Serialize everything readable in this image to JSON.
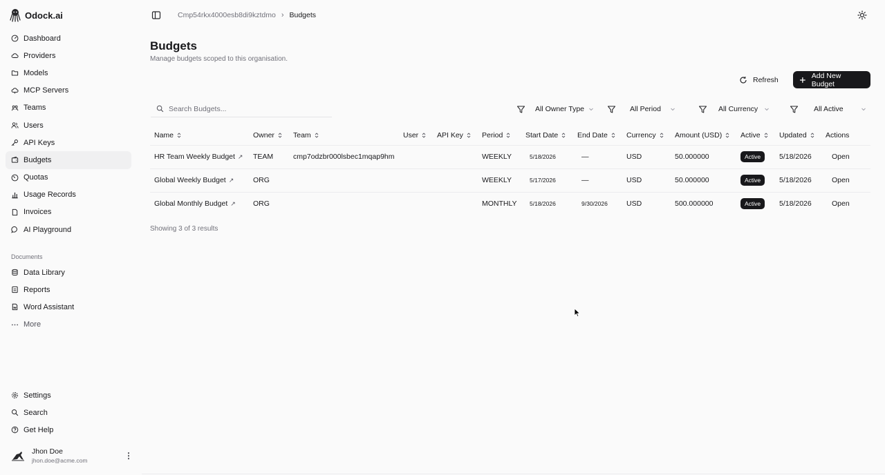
{
  "app": {
    "name": "Odock.ai"
  },
  "sidebar": {
    "items": [
      {
        "label": "Dashboard",
        "icon": "gauge-icon"
      },
      {
        "label": "Providers",
        "icon": "cloud-icon"
      },
      {
        "label": "Models",
        "icon": "folder-icon"
      },
      {
        "label": "MCP Servers",
        "icon": "cloud-server-icon"
      },
      {
        "label": "Teams",
        "icon": "team-icon"
      },
      {
        "label": "Users",
        "icon": "users-icon"
      },
      {
        "label": "API Keys",
        "icon": "key-icon"
      },
      {
        "label": "Budgets",
        "icon": "wallet-icon",
        "active": true
      },
      {
        "label": "Quotas",
        "icon": "gauge-alt-icon"
      },
      {
        "label": "Usage Records",
        "icon": "bar-chart-icon"
      },
      {
        "label": "Invoices",
        "icon": "file-icon"
      },
      {
        "label": "AI Playground",
        "icon": "chat-icon"
      }
    ],
    "documents_label": "Documents",
    "documents": [
      {
        "label": "Data Library",
        "icon": "database-icon"
      },
      {
        "label": "Reports",
        "icon": "report-icon"
      },
      {
        "label": "Word Assistant",
        "icon": "word-icon"
      },
      {
        "label": "More",
        "icon": "dots-icon"
      }
    ],
    "footer": [
      {
        "label": "Settings",
        "icon": "gear-icon"
      },
      {
        "label": "Search",
        "icon": "search-icon"
      },
      {
        "label": "Get Help",
        "icon": "help-icon"
      }
    ],
    "user": {
      "name": "Jhon Doe",
      "email": "jhon.doe@acme.com"
    }
  },
  "breadcrumb": {
    "org": "Cmp54rkx4000esb8di9kztdmo",
    "current": "Budgets"
  },
  "page": {
    "title": "Budgets",
    "subtitle": "Manage budgets scoped to this organisation.",
    "refresh_label": "Refresh",
    "add_label": "Add New Budget"
  },
  "search": {
    "placeholder": "Search Budgets..."
  },
  "filters": {
    "owner_type": "All Owner Type",
    "period": "All Period",
    "currency": "All Currency",
    "active": "All Active"
  },
  "table": {
    "columns": [
      "Name",
      "Owner",
      "Team",
      "User",
      "API Key",
      "Period",
      "Start Date",
      "End Date",
      "Currency",
      "Amount (USD)",
      "Active",
      "Updated",
      "Actions"
    ],
    "rows": [
      {
        "name": "HR Team Weekly Budget",
        "owner": "TEAM",
        "team": "cmp7odzbr000lsbec1mqap9hm",
        "user": "",
        "api_key": "",
        "period": "WEEKLY",
        "start": "5/18/2026",
        "end": "—",
        "currency": "USD",
        "amount": "50.000000",
        "active": "Active",
        "updated": "5/18/2026",
        "action": "Open"
      },
      {
        "name": "Global Weekly Budget",
        "owner": "ORG",
        "team": "",
        "user": "",
        "api_key": "",
        "period": "WEEKLY",
        "start": "5/17/2026",
        "end": "—",
        "currency": "USD",
        "amount": "50.000000",
        "active": "Active",
        "updated": "5/18/2026",
        "action": "Open"
      },
      {
        "name": "Global Monthly Budget",
        "owner": "ORG",
        "team": "",
        "user": "",
        "api_key": "",
        "period": "MONTHLY",
        "start": "5/18/2026",
        "end": "9/30/2026",
        "currency": "USD",
        "amount": "500.000000",
        "active": "Active",
        "updated": "5/18/2026",
        "action": "Open"
      }
    ],
    "results_text": "Showing 3 of 3 results"
  },
  "colors": {
    "primary": "#18181b",
    "muted": "#71717a",
    "background": "#fafafa",
    "active_bg": "#f0f0f1"
  }
}
